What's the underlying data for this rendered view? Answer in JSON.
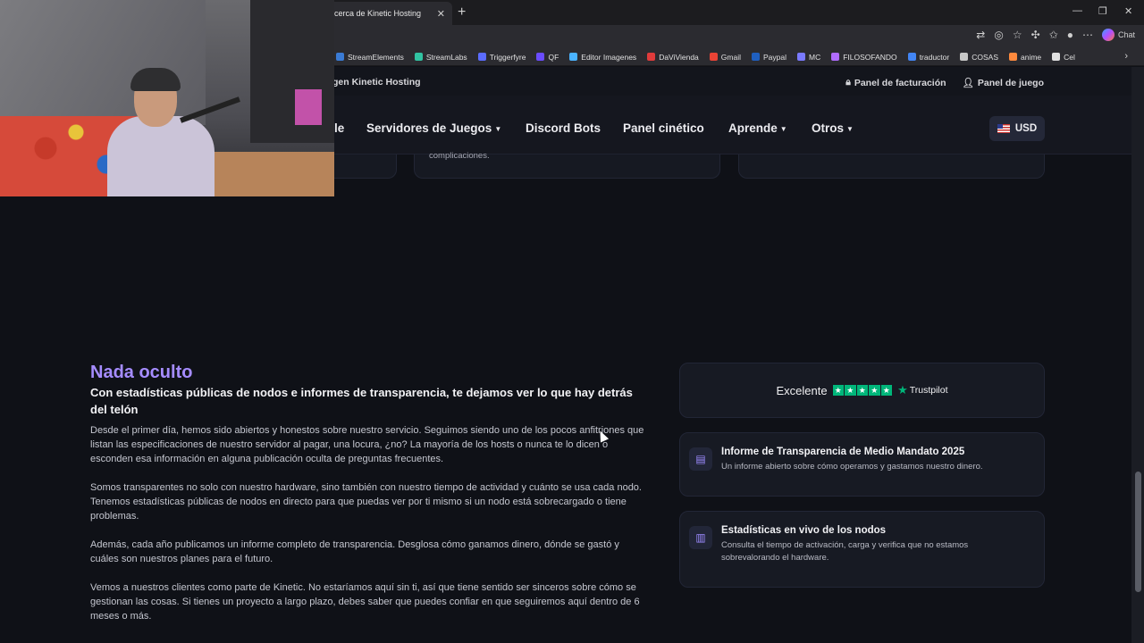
{
  "browser": {
    "tab_title": "cerca de Kinetic Hosting",
    "tab_close": "✕",
    "new_tab": "+",
    "chat_label": "Chat",
    "bookmarks": [
      {
        "label": "StreamElements",
        "color": "#3a7bd5"
      },
      {
        "label": "StreamLabs",
        "color": "#31c3a2"
      },
      {
        "label": "Triggerfyre",
        "color": "#5b6cff"
      },
      {
        "label": "QF",
        "color": "#6a4cff"
      },
      {
        "label": "Editor Imagenes",
        "color": "#4ab3ff"
      },
      {
        "label": "DaViVienda",
        "color": "#e03b3b"
      },
      {
        "label": "Gmail",
        "color": "#ea4335"
      },
      {
        "label": "Paypal",
        "color": "#1f5fbf"
      },
      {
        "label": "MC",
        "color": "#7a7aff"
      },
      {
        "label": "FILOSOFANDO",
        "color": "#b06cff"
      },
      {
        "label": "traductor",
        "color": "#4285f4"
      },
      {
        "label": "COSAS",
        "color": "#c8c8c8"
      },
      {
        "label": "anime",
        "color": "#ff8a3d"
      },
      {
        "label": "Cel",
        "color": "#e0e0e0"
      }
    ]
  },
  "site": {
    "brand": "gen Kinetic Hosting",
    "top_links": [
      "Panel de facturación",
      "Panel de juego"
    ],
    "nav": {
      "partial": "le",
      "games": "Servidores de Juegos",
      "discord": "Discord Bots",
      "panel": "Panel cinético",
      "learn": "Aprende",
      "others": "Otros"
    },
    "currency": "USD",
    "partial_card_text": "complicaciones."
  },
  "main": {
    "title": "Nada oculto",
    "subtitle": "Con estadísticas públicas de nodos e informes de transparencia, te dejamos ver lo que hay detrás del telón",
    "paragraphs": [
      "Desde el primer día, hemos sido abiertos y honestos sobre nuestro servicio. Seguimos siendo uno de los pocos anfitriones que listan las especificaciones de nuestro servidor al pagar, una locura, ¿no? La mayoría de los hosts o nunca te lo dicen o esconden esa información en alguna publicación oculta de preguntas frecuentes.",
      "Somos transparentes no solo con nuestro hardware, sino también con nuestro tiempo de actividad y cuánto se usa cada nodo. Tenemos estadísticas públicas de nodos en directo para que puedas ver por ti mismo si un nodo está sobrecargado o tiene problemas.",
      "Además, cada año publicamos un informe completo de transparencia. Desglosa cómo ganamos dinero, dónde se gastó y cuáles son nuestros planes para el futuro.",
      "Vemos a nuestros clientes como parte de Kinetic. No estaríamos aquí sin ti, así que tiene sentido ser sinceros sobre cómo se gestionan las cosas. Si tienes un proyecto a largo plazo, debes saber que puedes confiar en que seguiremos aquí dentro de 6 meses o más."
    ]
  },
  "trustpilot": {
    "rating_text": "Excelente",
    "brand": "Trustpilot",
    "stars": 5,
    "color": "#00b67a"
  },
  "cards": [
    {
      "icon": "document-icon",
      "title": "Informe de Transparencia de Medio Mandato 2025",
      "desc": "Un informe abierto sobre cómo operamos y gastamos nuestro dinero."
    },
    {
      "icon": "bar-chart-icon",
      "title": "Estadísticas en vivo de los nodos",
      "desc": "Consulta el tiempo de activación, carga y verifica que no estamos sobrevalorando el hardware."
    }
  ],
  "colors": {
    "accent": "#a58cff",
    "background": "#0f1117",
    "card": "#171a23"
  }
}
